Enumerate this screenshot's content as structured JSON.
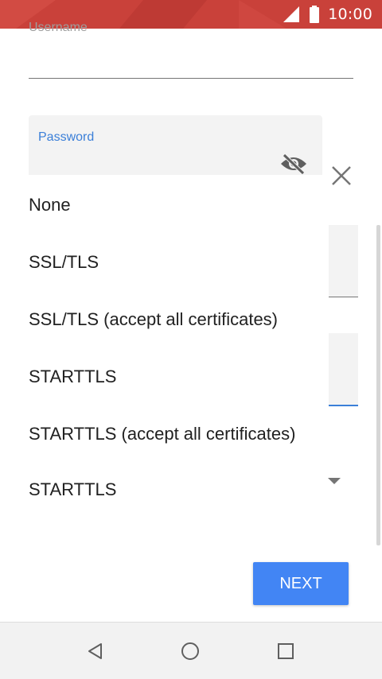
{
  "status_bar": {
    "time": "10:00",
    "color": "#c9413a",
    "icons": [
      "signal-icon",
      "battery-icon"
    ]
  },
  "form": {
    "username_label": "Username",
    "password_label": "Password",
    "password_icon": "visibility-off-icon",
    "label_accent_color": "#3b7fd8"
  },
  "dropdown": {
    "options": [
      "None",
      "SSL/TLS",
      "SSL/TLS (accept all certificates)",
      "STARTTLS",
      "STARTTLS (accept all certificates)"
    ],
    "selected_value": "STARTTLS"
  },
  "actions": {
    "next_label": "NEXT",
    "next_color": "#4285f4"
  },
  "nav_bar": {
    "buttons": [
      "back-icon",
      "home-icon",
      "recents-icon"
    ]
  }
}
